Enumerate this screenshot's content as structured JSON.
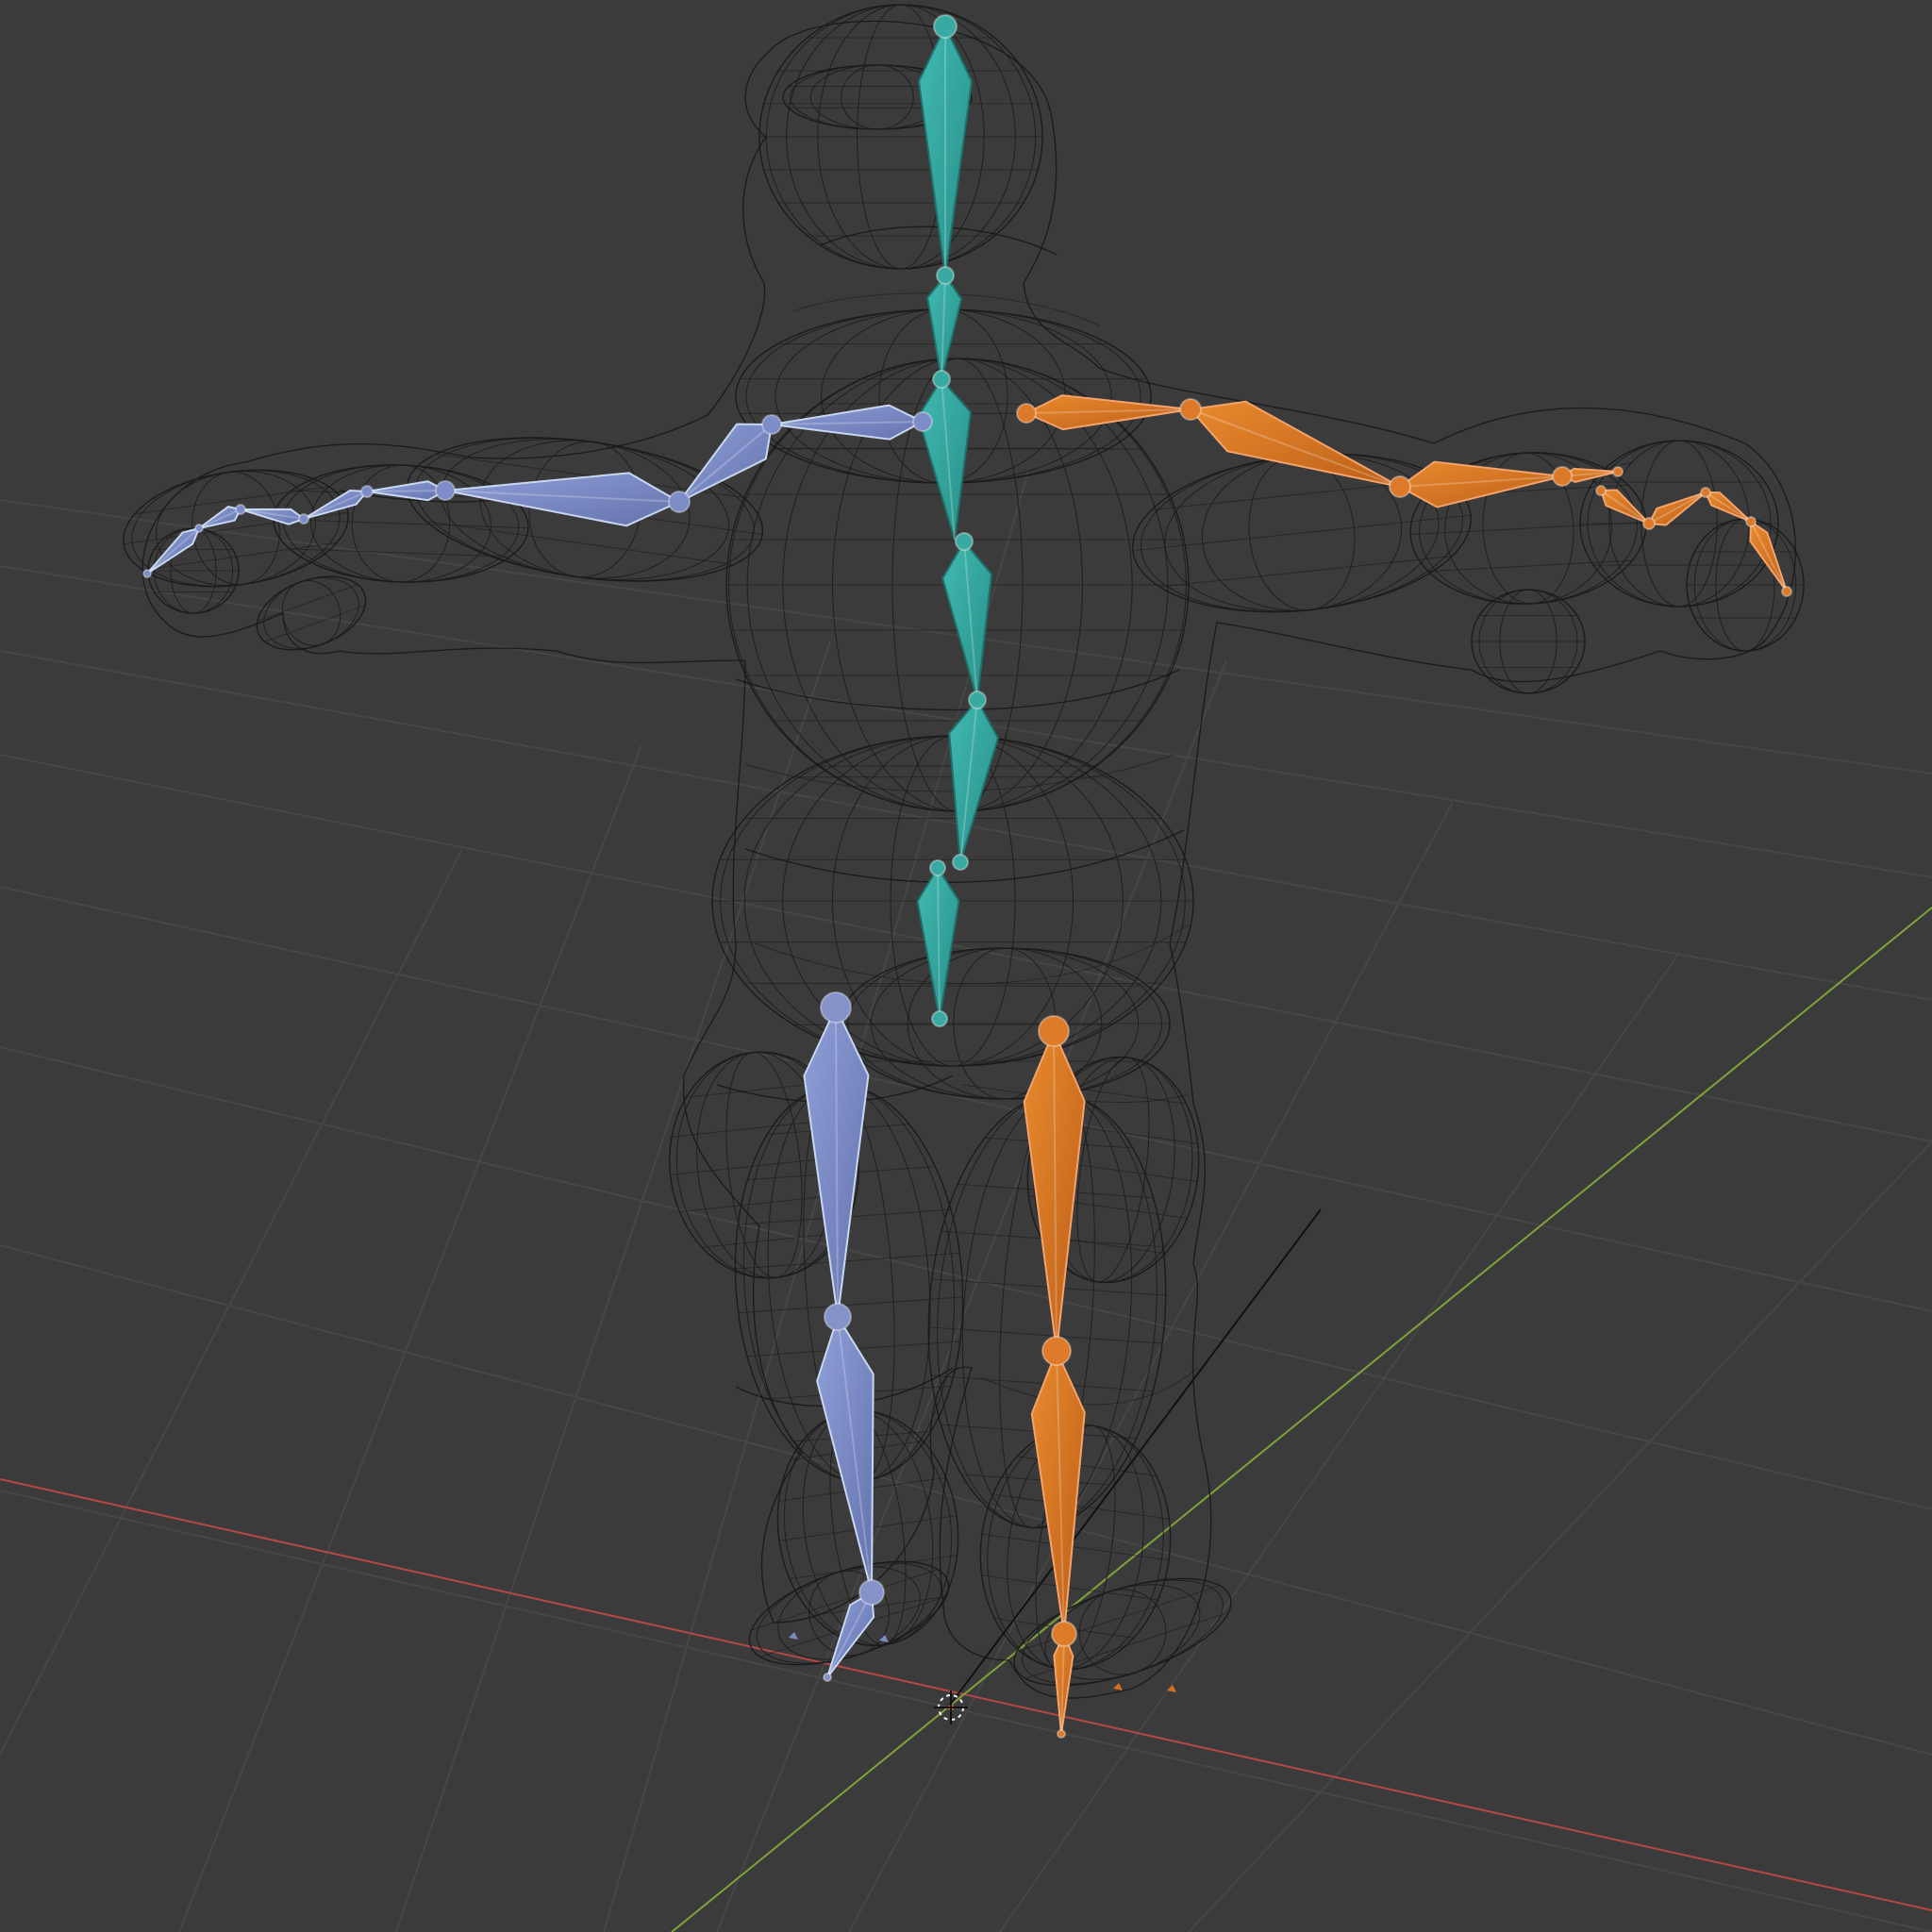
{
  "viewport": {
    "background": "#3b3b3b",
    "grid_color": "#464646",
    "x_axis_color": "#b64747",
    "y_axis_color": "#7fa33a"
  },
  "mesh": {
    "wire_color": "#151515"
  },
  "armature": {
    "center_color": "#2f9d95",
    "left_color": "#7383bd",
    "right_color": "#d16d1f",
    "bone_edge_color": "#c8d7f0"
  },
  "cursor": {
    "color": "#ff6b2d"
  }
}
